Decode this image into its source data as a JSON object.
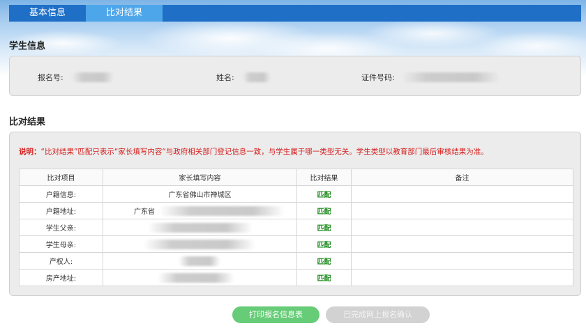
{
  "tabs": [
    "基本信息",
    "比对结果"
  ],
  "student_section": {
    "title": "学生信息",
    "fields": [
      {
        "label": "报名号:"
      },
      {
        "label": "姓名:"
      },
      {
        "label": "证件号码:"
      }
    ]
  },
  "result_section": {
    "title": "比对结果",
    "note_prefix": "说明：",
    "note_text": "“比对结果”匹配只表示“家长填写内容“与政府相关部门登记信息一致，与学生属于哪一类型无关。学生类型以教育部门最后审核结果为准。",
    "headers": [
      "比对项目",
      "家长填写内容",
      "比对结果",
      "备注"
    ],
    "rows": [
      {
        "item": "户籍信息:",
        "content": "广东省佛山市禅城区",
        "result": "匹配",
        "remark": ""
      },
      {
        "item": "户籍地址:",
        "content": "广东省",
        "result": "匹配",
        "remark": ""
      },
      {
        "item": "学生父亲:",
        "content": "",
        "result": "匹配",
        "remark": ""
      },
      {
        "item": "学生母亲:",
        "content": "",
        "result": "匹配",
        "remark": ""
      },
      {
        "item": "产权人:",
        "content": "",
        "result": "匹配",
        "remark": ""
      },
      {
        "item": "房产地址:",
        "content": "",
        "result": "匹配",
        "remark": ""
      }
    ]
  },
  "buttons": {
    "print": "打印报名信息表",
    "done": "已完成网上报名确认"
  },
  "colors": {
    "tab_bar": "#1f6fc7",
    "tab_active": "#4ea6ea",
    "note_red": "#d51a1a",
    "match_green": "#1c8a1c",
    "print_button": "#66cc77",
    "done_button": "#d2d2d2"
  }
}
